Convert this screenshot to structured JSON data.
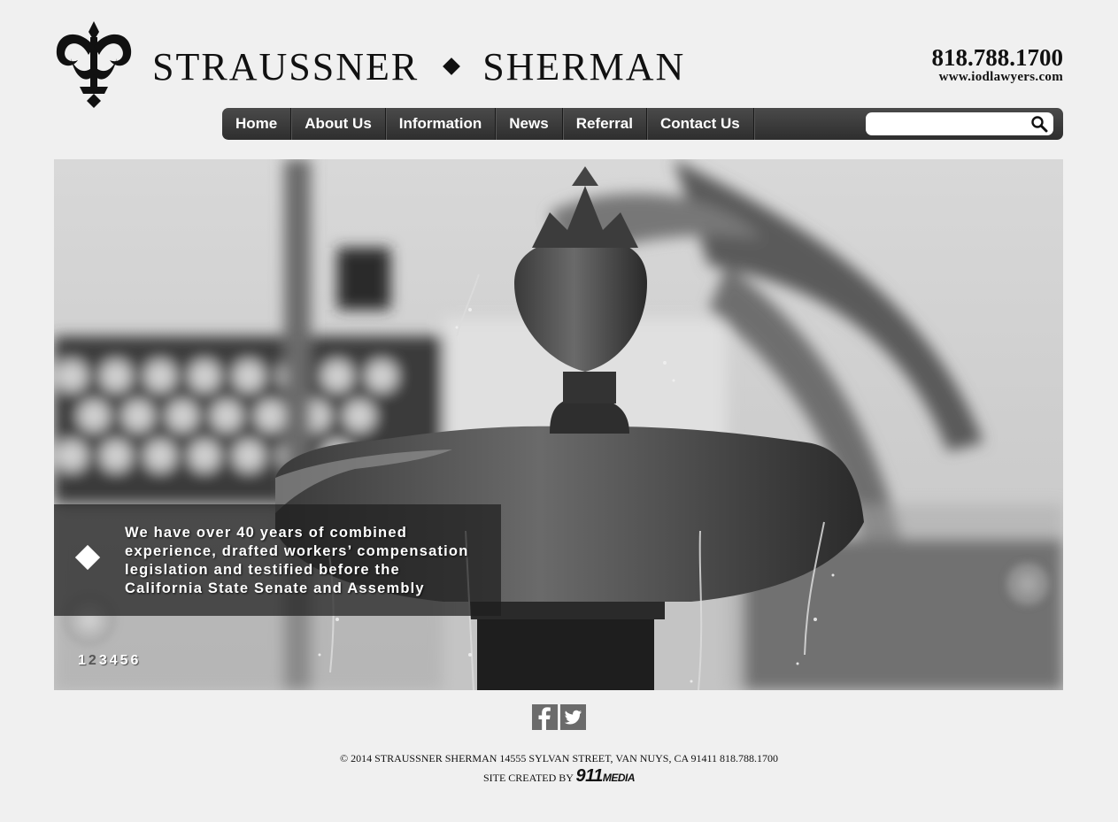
{
  "header": {
    "firm_left": "STRAUSSNER",
    "firm_right": "SHERMAN",
    "phone": "818.788.1700",
    "website": "www.iodlawyers.com"
  },
  "nav": {
    "items": [
      "Home",
      "About Us",
      "Information",
      "News",
      "Referral",
      "Contact Us"
    ]
  },
  "search": {
    "placeholder": "",
    "value": ""
  },
  "hero": {
    "caption_lines": [
      "We have over 40 years of combined",
      "experience, drafted workers’ compensation",
      "legislation and testified before the",
      "California State Senate and Assembly"
    ],
    "pages": [
      "1",
      "2",
      "3",
      "4",
      "5",
      "6"
    ],
    "active_page": "2"
  },
  "social": [
    "facebook-icon",
    "twitter-icon"
  ],
  "footer": {
    "copyright": "© 2014 STRAUSSNER SHERMAN 14555 SYLVAN STREET, VAN NUYS, CA 91411 818.788.1700",
    "credit_prefix": "SITE CREATED BY",
    "credit_brand_number": "911",
    "credit_brand_word": "MEDIA"
  },
  "colors": {
    "background": "#f0f0f0",
    "navbar": "#3a3a3a",
    "social": "#6b6b6b"
  }
}
